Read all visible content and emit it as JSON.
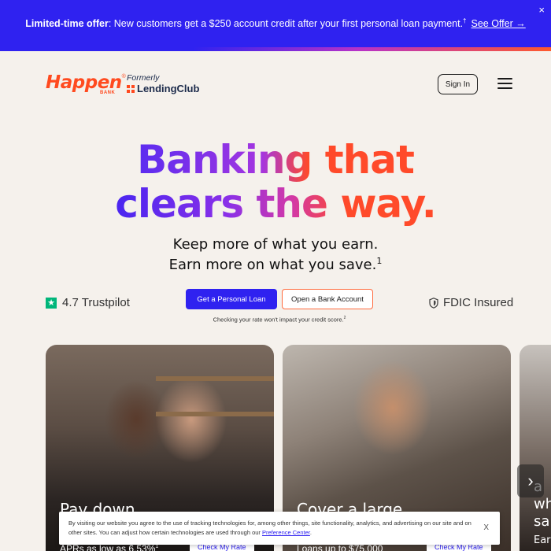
{
  "promo": {
    "bold": "Limited-time offer",
    "text": ": New customers get a $250 account credit after your first personal loan payment.",
    "sup": "†",
    "link": "See Offer →",
    "close": "×"
  },
  "header": {
    "logo_main": "Happen",
    "logo_reg": "®",
    "logo_sub": "BANK",
    "formerly": "Formerly",
    "formerly_brand": "LendingClub",
    "signin_label": "Sign In"
  },
  "hero": {
    "title_line1": "Banking that",
    "title_line2": "clears the way.",
    "subhead_line1": "Keep more of what you earn.",
    "subhead_line2": "Earn more on what you save.",
    "subhead_sup": "1"
  },
  "cta": {
    "trustpilot": "4.7 Trustpilot",
    "primary": "Get a Personal Loan",
    "secondary": "Open a Bank Account",
    "disclaimer": "Checking your rate won't impact your credit score.",
    "disclaimer_sup": "2",
    "fdic": "FDIC Insured"
  },
  "cards": [
    {
      "title": "Pay down",
      "sub": "APRs as low as 6.53%",
      "sub_sup": "1",
      "link": "Check My Rate"
    },
    {
      "title": "Cover a large",
      "sub": "Loans up to $75,000",
      "link": "Check My Rate"
    },
    {
      "peek_lines": [
        "a",
        "wh",
        "sa",
        "Ear"
      ]
    }
  ],
  "cookie": {
    "text": "By visiting our website you agree to the use of tracking technologies for, among other things, site functionality, analytics, and advertising on our site and on other sites. You can adjust how certain technologies are used through our ",
    "link": "Preference Center",
    "tail": ".",
    "close": "X"
  },
  "colors": {
    "brand_blue": "#2f22f0",
    "brand_orange": "#ff4a1f",
    "trustpilot_green": "#00b67a",
    "background": "#f5f1ec"
  },
  "icons": [
    "trustpilot-star-icon",
    "shield-icon",
    "menu-icon",
    "chevron-right-icon",
    "close-icon",
    "lendingclub-mark-icon"
  ]
}
